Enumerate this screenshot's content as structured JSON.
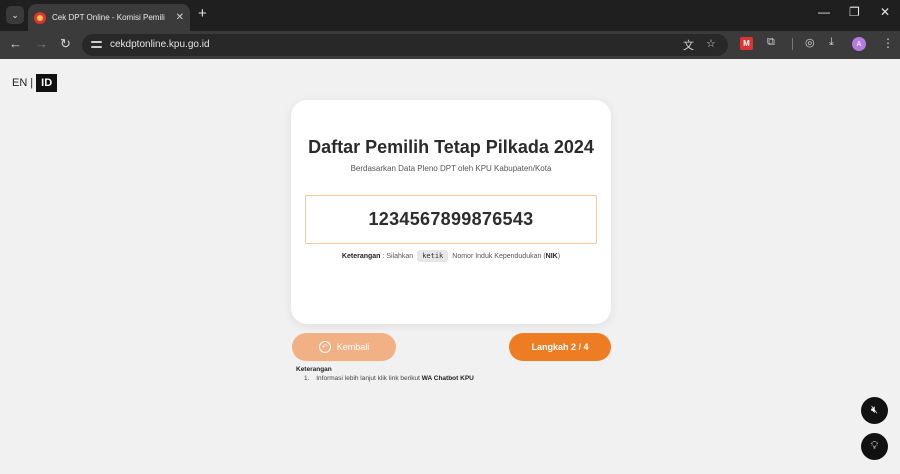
{
  "browser": {
    "tab_title": "Cek DPT Online - Komisi Pemili",
    "url": "cekdptonline.kpu.go.id",
    "new_tab": "+",
    "close": "✕",
    "minimize": "—",
    "restore": "❐",
    "window_close": "✕",
    "avatar_letter": "A"
  },
  "lang": {
    "en": "EN",
    "sep": "|",
    "id": "ID"
  },
  "card": {
    "title": "Daftar Pemilih Tetap Pilkada 2024",
    "subtitle": "Berdasarkan Data Pleno DPT oleh KPU Kabupaten/Kota",
    "nik_value": "1234567899876543",
    "hint_label": "Keterangan",
    "hint_pre": ": Silahkan",
    "hint_kbd": "ketik",
    "hint_mid": "Nomor Induk Kependudukan (",
    "hint_bold": "NIK",
    "hint_end": ")"
  },
  "buttons": {
    "back": "Kembali",
    "next": "Langkah 2 / 4"
  },
  "notes": {
    "title": "Keterangan",
    "item_no": "1.",
    "item_text": "Informasi lebih lanjut klik link berikut",
    "item_link": "WA Chatbot KPU"
  }
}
